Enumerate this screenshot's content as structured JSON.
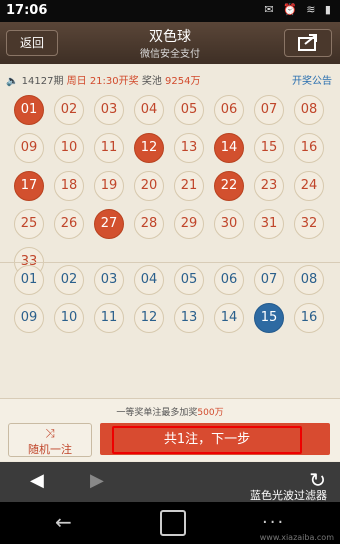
{
  "status_bar": {
    "time": "17:06",
    "icons": "✉ ⏰ ≋ ▮"
  },
  "header": {
    "back_label": "返回",
    "title": "双色球",
    "subtitle": "微信安全支付"
  },
  "info": {
    "issue": "14127期",
    "draw_time": "周日 21:30开奖",
    "pool_label": "奖池",
    "pool_amount": "9254万",
    "announcement_link": "开奖公告"
  },
  "red_balls": [
    "01",
    "02",
    "03",
    "04",
    "05",
    "06",
    "07",
    "08",
    "09",
    "10",
    "11",
    "12",
    "13",
    "14",
    "15",
    "16",
    "17",
    "18",
    "19",
    "20",
    "21",
    "22",
    "23",
    "24",
    "25",
    "26",
    "27",
    "28",
    "29",
    "30",
    "31",
    "32",
    "33"
  ],
  "red_selected": [
    "01",
    "12",
    "14",
    "17",
    "22",
    "27"
  ],
  "blue_balls": [
    "01",
    "02",
    "03",
    "04",
    "05",
    "06",
    "07",
    "08",
    "09",
    "10",
    "11",
    "12",
    "13",
    "14",
    "15",
    "16"
  ],
  "blue_selected": [
    "15"
  ],
  "footer": {
    "note_prefix": "一等奖单注最多加奖",
    "note_amount": "500万",
    "random_label": "随机一注",
    "next_label": "共1注，下一步"
  },
  "watermark": "蓝色光波过滤器",
  "watermark2": "www.xiazaiba.com",
  "colors": {
    "red_accent": "#d2502e",
    "blue_accent": "#2e6aa2"
  }
}
